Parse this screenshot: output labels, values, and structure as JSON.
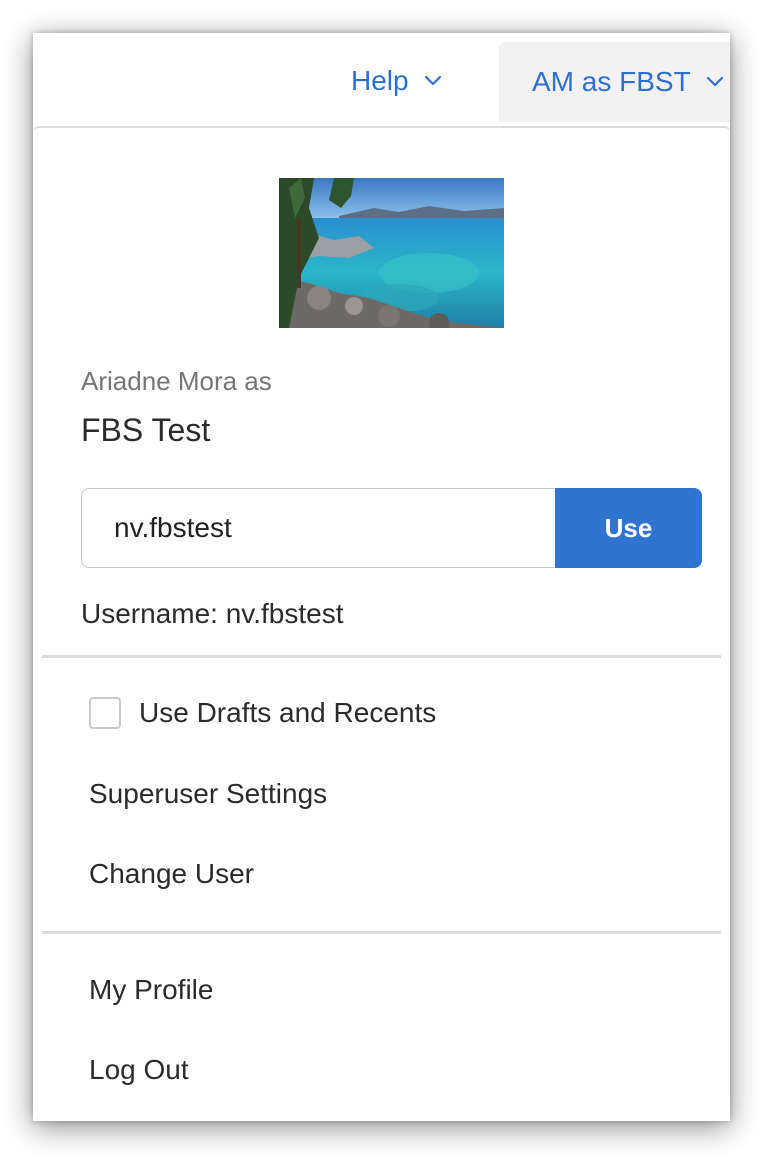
{
  "header": {
    "help_label": "Help",
    "user_menu_label": "AM as FBST"
  },
  "profile": {
    "photo_icon": "lake-landscape-photo",
    "subtitle": "Ariadne Mora as",
    "account_name": "FBS Test"
  },
  "switch_user": {
    "input_value": "nv.fbstest",
    "use_label": "Use",
    "username_line": "Username: nv.fbstest"
  },
  "menu": {
    "use_drafts_label": "Use Drafts and Recents",
    "use_drafts_checked": false,
    "superuser_settings_label": "Superuser Settings",
    "change_user_label": "Change User",
    "my_profile_label": "My Profile",
    "log_out_label": "Log Out"
  },
  "colors": {
    "accent": "#2f6fce",
    "button_bg": "#2f74d0",
    "divider": "#dcdcdc"
  }
}
